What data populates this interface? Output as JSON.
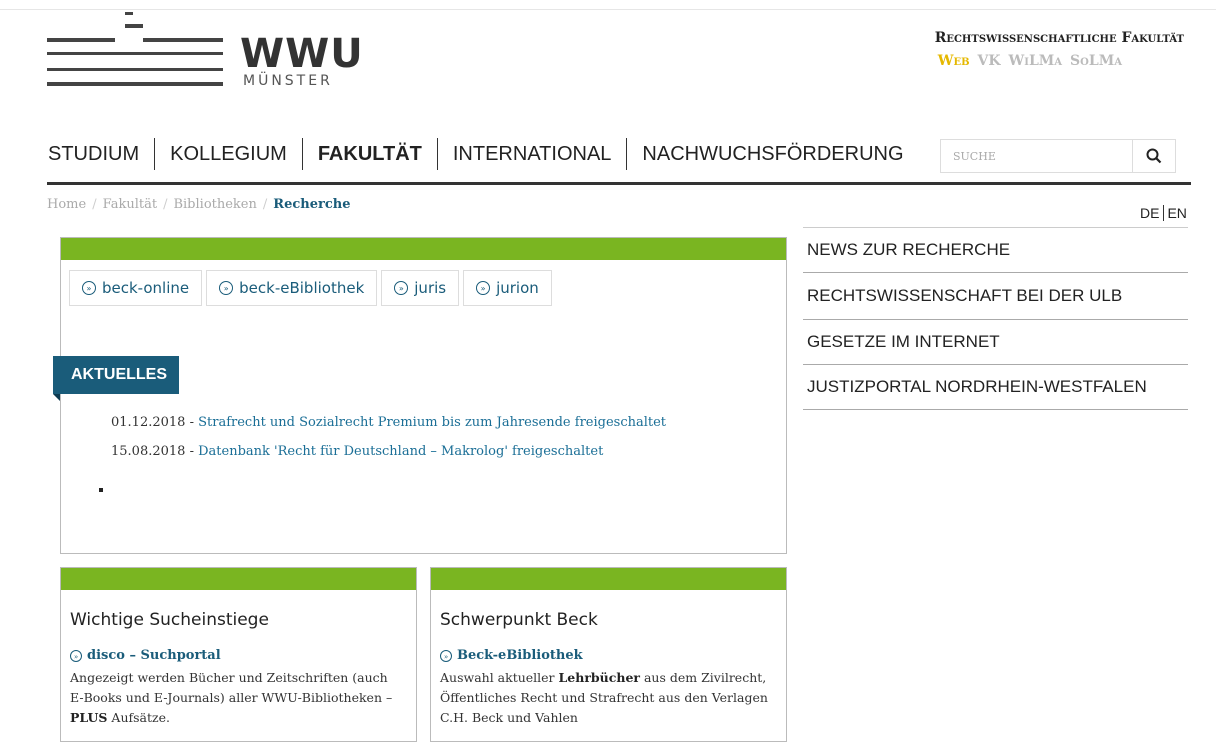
{
  "logo": {
    "name": "WWU",
    "sub": "MÜNSTER"
  },
  "faculty": {
    "title": "Rechtswissenschaftliche Fakultät",
    "links": [
      "Web",
      "VK",
      "WiLMa",
      "SoLMa"
    ]
  },
  "nav": {
    "items": [
      "STUDIUM",
      "KOLLEGIUM",
      "FAKULTÄT",
      "INTERNATIONAL",
      "NACHWUCHSFÖRDERUNG"
    ],
    "active_index": 2
  },
  "search": {
    "placeholder": "SUCHE",
    "icon": "search-icon"
  },
  "breadcrumb": {
    "items": [
      "Home",
      "Fakultät",
      "Bibliotheken"
    ],
    "current": "Recherche",
    "separator": "/"
  },
  "lang": {
    "de": "DE",
    "en": "EN"
  },
  "sidebar": {
    "links": [
      "NEWS ZUR RECHERCHE",
      "RECHTSWISSENSCHAFT BEI DER ULB",
      "GESETZE IM INTERNET",
      "JUSTIZPORTAL NORDRHEIN-WESTFALEN"
    ]
  },
  "main_box": {
    "tabs": [
      "beck-online",
      "beck-eBibliothek",
      "juris",
      "jurion"
    ],
    "section_label": "AKTUELLES",
    "news": [
      {
        "date": "01.12.2018",
        "sep": " - ",
        "text": "Strafrecht und Sozialrecht Premium bis zum Jahresende freigeschaltet"
      },
      {
        "date": "15.08.2018",
        "sep": " - ",
        "text": "Datenbank 'Recht für Deutschland – Makrolog' freigeschaltet"
      }
    ]
  },
  "cards": [
    {
      "title": "Wichtige Sucheinstiege",
      "link": "disco – Suchportal",
      "text_a": "Angezeigt werden Bücher und Zeitschriften (auch E-Books und E-Journals) aller WWU-Bibliotheken – ",
      "text_bold": "PLUS",
      "text_b": " Aufsätze."
    },
    {
      "title": "Schwerpunkt Beck",
      "link": "Beck-eBibliothek",
      "text_a": "Auswahl aktueller ",
      "text_bold": "Lehrbücher",
      "text_b": " aus dem Zivilrecht, Öffentliches Recht und Strafrecht aus den Verlagen C.H. Beck und Vahlen"
    }
  ],
  "colors": {
    "green": "#7ab521",
    "teal": "#1a5c7a",
    "link": "#1a6e96",
    "active_link": "#e5b800"
  }
}
